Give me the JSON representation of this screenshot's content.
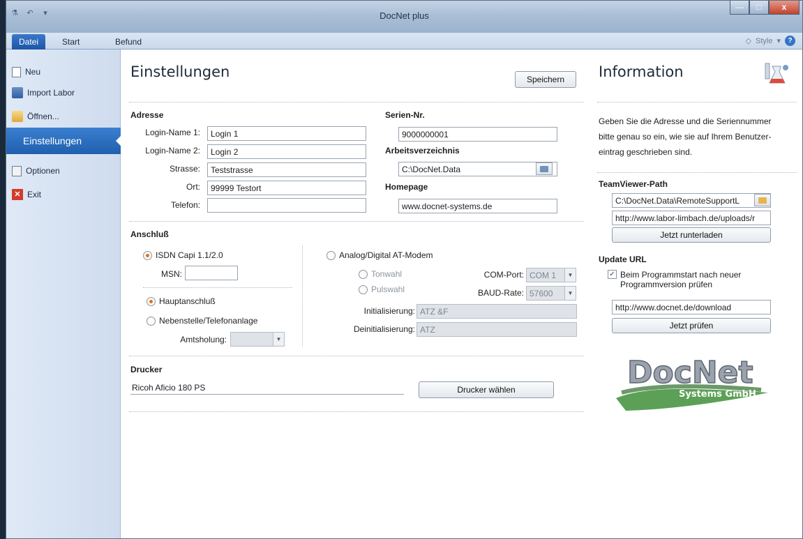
{
  "window": {
    "title": "DocNet plus"
  },
  "window_controls": {
    "minimize": "—",
    "maximize": "□",
    "close": "x"
  },
  "ribbon": {
    "tabs": [
      "Datei",
      "Start",
      "Befund"
    ],
    "style_label": "Style"
  },
  "nav": {
    "items": [
      {
        "label": "Neu",
        "icon": "new-document-icon"
      },
      {
        "label": "Import Labor",
        "icon": "import-icon"
      },
      {
        "label": "Öffnen...",
        "icon": "folder-open-icon"
      },
      {
        "label": "Einstellungen",
        "active": true
      },
      {
        "label": "Optionen",
        "icon": "options-icon"
      },
      {
        "label": "Exit",
        "icon": "exit-icon"
      }
    ]
  },
  "settings": {
    "title": "Einstellungen",
    "save_label": "Speichern",
    "address": {
      "heading": "Adresse",
      "login1_label": "Login-Name 1:",
      "login1_value": "Login 1",
      "login2_label": "Login-Name 2:",
      "login2_value": "Login 2",
      "street_label": "Strasse:",
      "street_value": "Teststrasse",
      "city_label": "Ort:",
      "city_value": "99999 Testort",
      "phone_label": "Telefon:",
      "phone_value": ""
    },
    "serial": {
      "heading": "Serien-Nr.",
      "value": "9000000001"
    },
    "workdir": {
      "heading": "Arbeitsverzeichnis",
      "value": "C:\\DocNet.Data"
    },
    "homepage": {
      "heading": "Homepage",
      "value": "www.docnet-systems.de"
    },
    "connection": {
      "heading": "Anschluß",
      "isdn_label": "ISDN Capi 1.1/2.0",
      "msn_label": "MSN:",
      "msn_value": "",
      "main_line_label": "Hauptanschluß",
      "extension_label": "Nebenstelle/Telefonanlage",
      "amt_label": "Amtsholung:",
      "amt_value": "",
      "modem_label": "Analog/Digital AT-Modem",
      "tone_label": "Tonwahl",
      "pulse_label": "Pulswahl",
      "comport_label": "COM-Port:",
      "comport_value": "COM 1",
      "baud_label": "BAUD-Rate:",
      "baud_value": "57600",
      "init_label": "Initialisierung:",
      "init_value": "ATZ &F",
      "deinit_label": "Deinitialisierung:",
      "deinit_value": "ATZ"
    },
    "printer": {
      "heading": "Drucker",
      "value": "Ricoh Aficio 180 PS",
      "choose_label": "Drucker wählen"
    }
  },
  "info": {
    "title": "Information",
    "text_line1": "Geben Sie die Adresse und die Seriennummer",
    "text_line2": "bitte genau so ein, wie sie auf Ihrem Benutzer-",
    "text_line3": "eintrag geschrieben sind.",
    "teamviewer": {
      "heading": "TeamViewer-Path",
      "path_value": "C:\\DocNet.Data\\RemoteSupportL",
      "url_value": "http://www.labor-limbach.de/uploads/r",
      "download_label": "Jetzt runterladen"
    },
    "update": {
      "heading": "Update URL",
      "check_label_line1": "Beim Programmstart nach neuer",
      "check_label_line2": "Programmversion prüfen",
      "checked": true,
      "url_value": "http://www.docnet.de/download",
      "check_now_label": "Jetzt prüfen"
    },
    "logo": {
      "word": "DocNet",
      "company": "Systems GmbH"
    }
  }
}
